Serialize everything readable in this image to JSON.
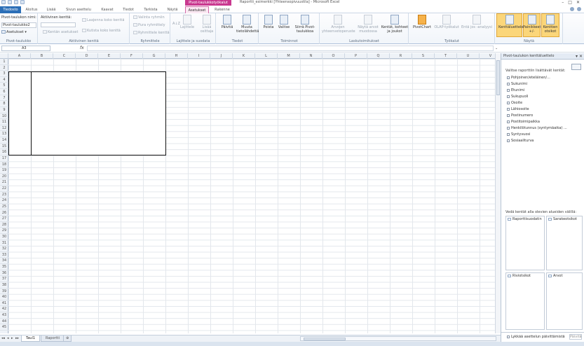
{
  "titlebar": {
    "context_group": "Pivot-taulukkotyökalut",
    "document_title": "Raportti_esimerkki [Yhteensopivuustila] - Microsoft Excel",
    "window_controls": [
      "–",
      "□",
      "✕"
    ]
  },
  "tabs": [
    {
      "label": "Tiedosto",
      "type": "file"
    },
    {
      "label": "Aloitus"
    },
    {
      "label": "Lisää"
    },
    {
      "label": "Sivun asettelu"
    },
    {
      "label": "Kaavat"
    },
    {
      "label": "Tiedot"
    },
    {
      "label": "Tarkista"
    },
    {
      "label": "Näytä"
    },
    {
      "label": "Asetukset",
      "type": "active"
    },
    {
      "label": "Rakenne"
    }
  ],
  "ribbon": {
    "pivot_table": {
      "name_label": "Pivot-taulukon nimi:",
      "name_value": "Pivot-taulukko2",
      "options_button": "Asetukset",
      "group_label": "Pivot-taulukko"
    },
    "active_field": {
      "label": "Aktiivinen kenttä:",
      "settings_button": "Kentän asetukset",
      "expand_button": "Laajenna koko kenttä",
      "collapse_button": "Kutista koko kenttä",
      "group_label": "Aktiivinen kenttä"
    },
    "group": {
      "selection": "Valinta ryhmiin",
      "ungroup": "Pura ryhmittely",
      "field": "Ryhmittele kenttä",
      "group_label": "Ryhmittele"
    },
    "sort_filter": {
      "sort": "Lajittele",
      "slicer": "Lisää osittaja",
      "group_label": "Lajittele ja suodata"
    },
    "data": {
      "refresh": "Päivitä",
      "change_source": "Muuta tietolähdettä",
      "group_label": "Tiedot"
    },
    "actions": {
      "clear": "Poista",
      "select": "Valitse",
      "move": "Siirrä Pivot-taulukkoa",
      "group_label": "Toiminnot"
    },
    "calculations": {
      "summarize": "Arvojen yhteenvetoperuste",
      "show_values": "Näytä arvot muodossa",
      "fields_items": "Kentät, kohteet ja joukot",
      "group_label": "Laskutoimitukset"
    },
    "tools": {
      "pivotchart": "PivotChart",
      "olap": "OLAP-työkalut",
      "whatif": "Entä jos -analyysi",
      "group_label": "Työkalut"
    },
    "show": {
      "field_list": "Kenttäluettelo",
      "buttons": "Painikkeet +/-",
      "headers": "Kenttien otsikot",
      "group_label": "Näytä"
    }
  },
  "formula_bar": {
    "cell_ref": "A3",
    "fx": "fx",
    "formula": ""
  },
  "grid": {
    "columns": [
      "A",
      "B",
      "C",
      "D",
      "E",
      "F",
      "G",
      "H",
      "I",
      "J",
      "K",
      "L",
      "M",
      "N",
      "O",
      "P",
      "Q",
      "R",
      "S",
      "T",
      "U",
      "V"
    ],
    "rows": [
      "1",
      "2",
      "3",
      "4",
      "5",
      "6",
      "7",
      "8",
      "9",
      "10",
      "11",
      "12",
      "13",
      "14",
      "15",
      "16",
      "17",
      "18",
      "19",
      "20",
      "21",
      "22",
      "23",
      "24",
      "25",
      "26",
      "27",
      "28",
      "29",
      "30",
      "31",
      "32",
      "33",
      "34",
      "35",
      "36",
      "37",
      "38",
      "39",
      "40",
      "41",
      "42",
      "43",
      "44",
      "45"
    ]
  },
  "sheets": {
    "tabs": [
      "Taul1",
      "Raportti"
    ],
    "active": "Taul1",
    "nav_arrows": [
      "◂◂",
      "◂",
      "▸",
      "▸▸"
    ]
  },
  "field_pane": {
    "title": "Pivot-taulukon kenttäluettelo",
    "subtitle": "Valitse raporttiin lisättävät kentät:",
    "fields": [
      "Pohjoinen/eteläinen/...",
      "Sukunimi",
      "Etunimi",
      "Sukupuoli",
      "Osoite",
      "Lähiosoite",
      "Postinumero",
      "Postitoimipaikka",
      "Henkilötunnus (syntymäaika) ...",
      "Syntyvuosi",
      "Sosiaaliturva"
    ],
    "drag_caption": "Vedä kentät alla olevien alueiden välillä:",
    "areas": {
      "report_filter": "Raporttisuodatin",
      "column_labels": "Sarakeotsikot",
      "row_labels": "Riviotsikot",
      "values": "Arvot"
    },
    "defer_label": "Lykkää asettelun päivittämistä",
    "update_button": "Päivitä"
  }
}
